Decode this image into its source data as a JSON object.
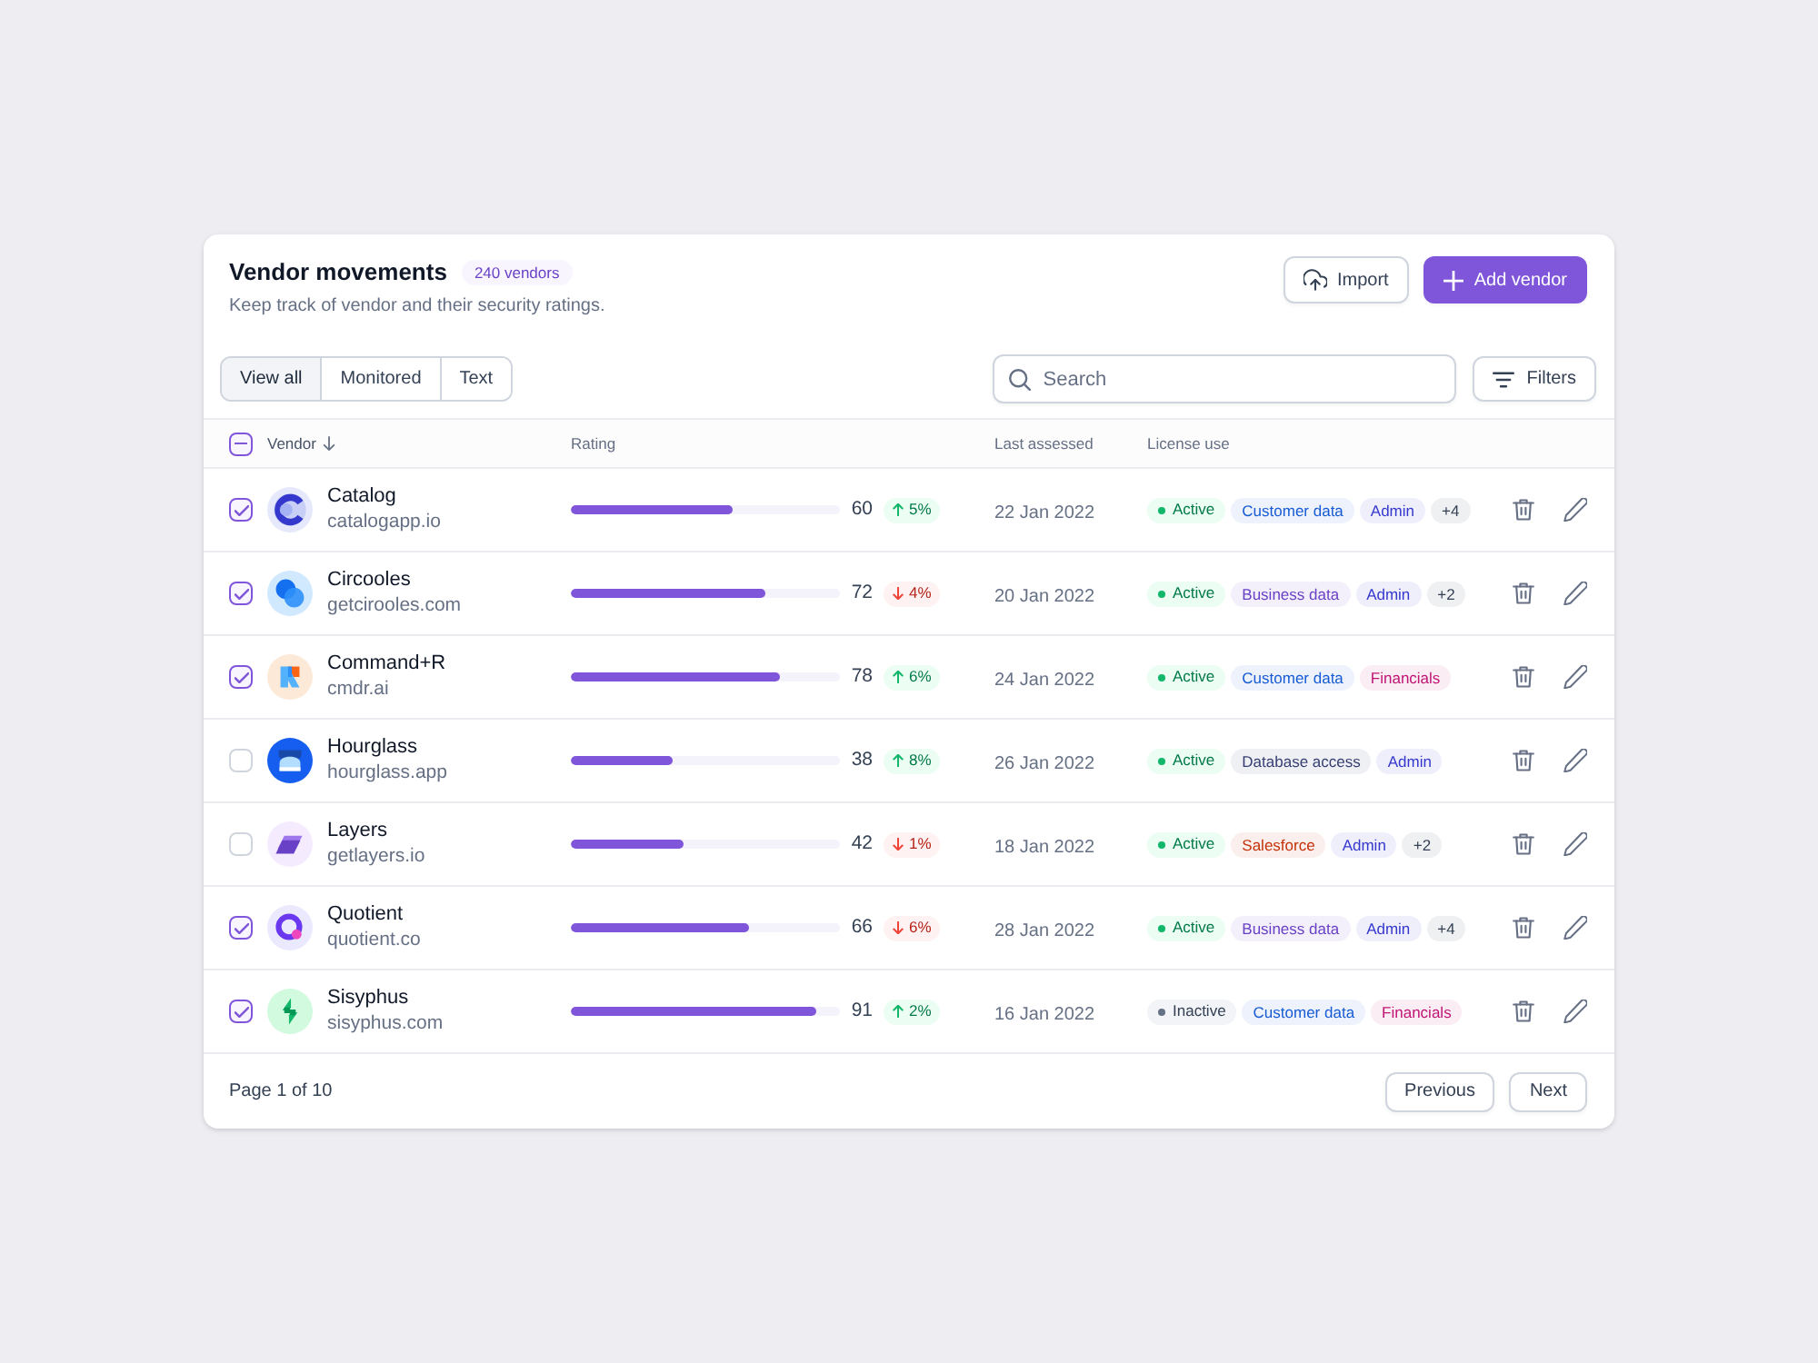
{
  "header": {
    "title": "Vendor movements",
    "badge": "240 vendors",
    "subtitle": "Keep track of vendor and their security ratings.",
    "buttons": [
      {
        "label": "Import",
        "kind": "secondary"
      },
      {
        "label": "Add vendor",
        "kind": "primary"
      }
    ]
  },
  "tabs": [
    {
      "label": "View all",
      "selected": true
    },
    {
      "label": "Monitored",
      "selected": false
    },
    {
      "label": "Text",
      "selected": false
    }
  ],
  "search": {
    "placeholder": "Search"
  },
  "filters_button": {
    "label": "Filters"
  },
  "table": {
    "select_all": {
      "indeterminate": true
    },
    "columns": [
      {
        "label": "Vendor",
        "sorted": true
      },
      {
        "label": "Rating",
        "sorted": false
      },
      {
        "label": "Last assessed",
        "sorted": false
      },
      {
        "label": "License use",
        "sorted": false
      }
    ],
    "rows": [
      {
        "name": "Catalog",
        "domain": "catalogapp.io",
        "checked": true,
        "rating": "60",
        "level": 0.6,
        "change": {
          "label": "5%",
          "kind": "up"
        },
        "date": "22 Jan 2022",
        "status": {
          "label": "Active",
          "active": true
        },
        "tags": [
          {
            "label": "Customer data",
            "color": "#175cd3"
          },
          {
            "label": "Admin",
            "color": "#3538cd"
          },
          {
            "label": "+4",
            "color": "#344054"
          }
        ]
      },
      {
        "name": "Circooles",
        "domain": "getcirooles.com",
        "checked": true,
        "rating": "72",
        "level": 0.72,
        "change": {
          "label": "4%",
          "kind": "down"
        },
        "date": "20 Jan 2022",
        "status": {
          "label": "Active",
          "active": true
        },
        "tags": [
          {
            "label": "Business data",
            "color": "#6941c6"
          },
          {
            "label": "Admin",
            "color": "#3538cd"
          },
          {
            "label": "+2",
            "color": "#344054"
          }
        ]
      },
      {
        "name": "Command+R",
        "domain": "cmdr.ai",
        "checked": true,
        "rating": "78",
        "level": 0.78,
        "change": {
          "label": "6%",
          "kind": "up"
        },
        "date": "24 Jan 2022",
        "status": {
          "label": "Active",
          "active": true
        },
        "tags": [
          {
            "label": "Customer data",
            "color": "#175cd3"
          },
          {
            "label": "Financials",
            "color": "#c11574"
          }
        ]
      },
      {
        "name": "Hourglass",
        "domain": "hourglass.app",
        "checked": false,
        "rating": "38",
        "level": 0.38,
        "change": {
          "label": "8%",
          "kind": "up"
        },
        "date": "26 Jan 2022",
        "status": {
          "label": "Active",
          "active": true
        },
        "tags": [
          {
            "label": "Database access",
            "color": "#363f72"
          },
          {
            "label": "Admin",
            "color": "#3538cd"
          }
        ]
      },
      {
        "name": "Layers",
        "domain": "getlayers.io",
        "checked": false,
        "rating": "42",
        "level": 0.42,
        "change": {
          "label": "1%",
          "kind": "down"
        },
        "date": "18 Jan 2022",
        "status": {
          "label": "Active",
          "active": true
        },
        "tags": [
          {
            "label": "Salesforce",
            "color": "#c4320a"
          },
          {
            "label": "Admin",
            "color": "#3538cd"
          },
          {
            "label": "+2",
            "color": "#344054"
          }
        ]
      },
      {
        "name": "Quotient",
        "domain": "quotient.co",
        "checked": true,
        "rating": "66",
        "level": 0.66,
        "change": {
          "label": "6%",
          "kind": "down"
        },
        "date": "28 Jan 2022",
        "status": {
          "label": "Active",
          "active": true
        },
        "tags": [
          {
            "label": "Business data",
            "color": "#6941c6"
          },
          {
            "label": "Admin",
            "color": "#3538cd"
          },
          {
            "label": "+4",
            "color": "#344054"
          }
        ]
      },
      {
        "name": "Sisyphus",
        "domain": "sisyphus.com",
        "checked": true,
        "rating": "91",
        "level": 0.91,
        "change": {
          "label": "2%",
          "kind": "up"
        },
        "date": "16 Jan 2022",
        "status": {
          "label": "Inactive",
          "active": false
        },
        "tags": [
          {
            "label": "Customer data",
            "color": "#175cd3"
          },
          {
            "label": "Financials",
            "color": "#c11574"
          }
        ]
      }
    ]
  },
  "pagination": {
    "page_label": "Page 1 of 10",
    "buttons": [
      "Previous",
      "Next"
    ]
  }
}
